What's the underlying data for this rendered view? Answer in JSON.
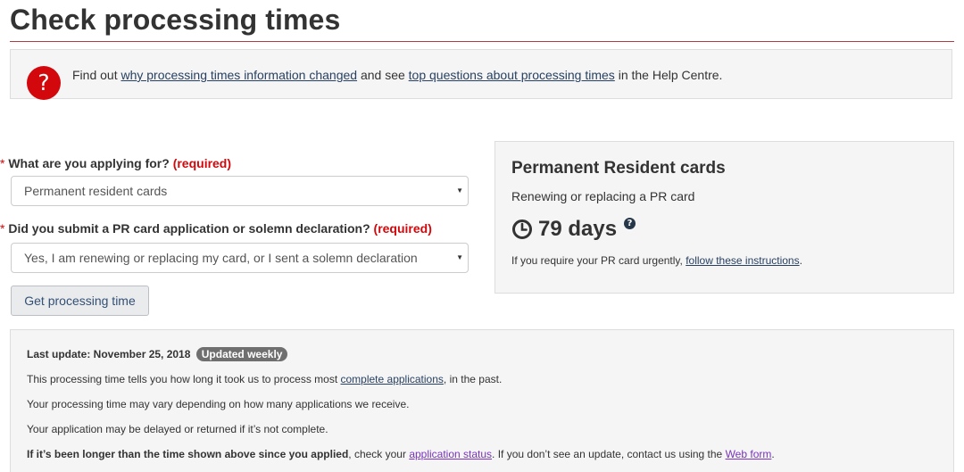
{
  "page": {
    "title": "Check processing times"
  },
  "help": {
    "icon": "question-icon",
    "text_before": "Find out ",
    "link1": "why processing times information changed",
    "text_middle": " and see ",
    "link2": "top questions about processing times",
    "text_after": " in the Help Centre."
  },
  "form": {
    "q1": {
      "star": "*",
      "label": " What are you applying for? ",
      "required": "(required)",
      "value": "Permanent resident cards"
    },
    "q2": {
      "star": "*",
      "label": " Did you submit a PR card application or solemn declaration? ",
      "required": "(required)",
      "value": "Yes, I am renewing or replacing my card, or I sent a solemn declaration"
    },
    "submit_label": "Get processing time"
  },
  "result": {
    "title": "Permanent Resident cards",
    "subtitle": "Renewing or replacing a PR card",
    "days": "79 days",
    "clock_icon": "clock-icon",
    "help_icon": "question-circle-icon",
    "note_before": "If you require your PR card urgently, ",
    "note_link": "follow these instructions",
    "note_after": "."
  },
  "info": {
    "last_update": "Last update: November 25, 2018",
    "badge": "Updated weekly",
    "line1_before": "This processing time tells you how long it took us to process most ",
    "line1_link": "complete applications",
    "line1_after": ", in the past.",
    "line2": "Your processing time may vary depending on how many applications we receive.",
    "line3": "Your application may be delayed or returned if it’s not complete.",
    "line4_bold": "If it’s been longer than the time shown above since you applied",
    "line4_mid": ", check your ",
    "line4_link1": "application status",
    "line4_mid2": ". If you don’t see an update, contact us using the ",
    "line4_link2": "Web form",
    "line4_end": "."
  },
  "colors": {
    "rule": "#af3c43",
    "required": "#d3080c",
    "link": "#284162",
    "visited_link": "#7834bc",
    "badge": "#6f6f6f"
  }
}
